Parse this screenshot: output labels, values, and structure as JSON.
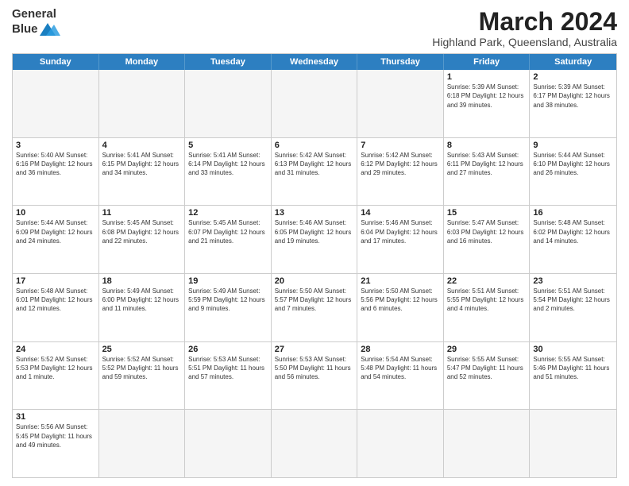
{
  "logo": {
    "general": "General",
    "blue": "Blue"
  },
  "title": "March 2024",
  "subtitle": "Highland Park, Queensland, Australia",
  "days": [
    "Sunday",
    "Monday",
    "Tuesday",
    "Wednesday",
    "Thursday",
    "Friday",
    "Saturday"
  ],
  "weeks": [
    [
      {
        "day": "",
        "info": ""
      },
      {
        "day": "",
        "info": ""
      },
      {
        "day": "",
        "info": ""
      },
      {
        "day": "",
        "info": ""
      },
      {
        "day": "",
        "info": ""
      },
      {
        "day": "1",
        "info": "Sunrise: 5:39 AM\nSunset: 6:18 PM\nDaylight: 12 hours and 39 minutes."
      },
      {
        "day": "2",
        "info": "Sunrise: 5:39 AM\nSunset: 6:17 PM\nDaylight: 12 hours and 38 minutes."
      }
    ],
    [
      {
        "day": "3",
        "info": "Sunrise: 5:40 AM\nSunset: 6:16 PM\nDaylight: 12 hours and 36 minutes."
      },
      {
        "day": "4",
        "info": "Sunrise: 5:41 AM\nSunset: 6:15 PM\nDaylight: 12 hours and 34 minutes."
      },
      {
        "day": "5",
        "info": "Sunrise: 5:41 AM\nSunset: 6:14 PM\nDaylight: 12 hours and 33 minutes."
      },
      {
        "day": "6",
        "info": "Sunrise: 5:42 AM\nSunset: 6:13 PM\nDaylight: 12 hours and 31 minutes."
      },
      {
        "day": "7",
        "info": "Sunrise: 5:42 AM\nSunset: 6:12 PM\nDaylight: 12 hours and 29 minutes."
      },
      {
        "day": "8",
        "info": "Sunrise: 5:43 AM\nSunset: 6:11 PM\nDaylight: 12 hours and 27 minutes."
      },
      {
        "day": "9",
        "info": "Sunrise: 5:44 AM\nSunset: 6:10 PM\nDaylight: 12 hours and 26 minutes."
      }
    ],
    [
      {
        "day": "10",
        "info": "Sunrise: 5:44 AM\nSunset: 6:09 PM\nDaylight: 12 hours and 24 minutes."
      },
      {
        "day": "11",
        "info": "Sunrise: 5:45 AM\nSunset: 6:08 PM\nDaylight: 12 hours and 22 minutes."
      },
      {
        "day": "12",
        "info": "Sunrise: 5:45 AM\nSunset: 6:07 PM\nDaylight: 12 hours and 21 minutes."
      },
      {
        "day": "13",
        "info": "Sunrise: 5:46 AM\nSunset: 6:05 PM\nDaylight: 12 hours and 19 minutes."
      },
      {
        "day": "14",
        "info": "Sunrise: 5:46 AM\nSunset: 6:04 PM\nDaylight: 12 hours and 17 minutes."
      },
      {
        "day": "15",
        "info": "Sunrise: 5:47 AM\nSunset: 6:03 PM\nDaylight: 12 hours and 16 minutes."
      },
      {
        "day": "16",
        "info": "Sunrise: 5:48 AM\nSunset: 6:02 PM\nDaylight: 12 hours and 14 minutes."
      }
    ],
    [
      {
        "day": "17",
        "info": "Sunrise: 5:48 AM\nSunset: 6:01 PM\nDaylight: 12 hours and 12 minutes."
      },
      {
        "day": "18",
        "info": "Sunrise: 5:49 AM\nSunset: 6:00 PM\nDaylight: 12 hours and 11 minutes."
      },
      {
        "day": "19",
        "info": "Sunrise: 5:49 AM\nSunset: 5:59 PM\nDaylight: 12 hours and 9 minutes."
      },
      {
        "day": "20",
        "info": "Sunrise: 5:50 AM\nSunset: 5:57 PM\nDaylight: 12 hours and 7 minutes."
      },
      {
        "day": "21",
        "info": "Sunrise: 5:50 AM\nSunset: 5:56 PM\nDaylight: 12 hours and 6 minutes."
      },
      {
        "day": "22",
        "info": "Sunrise: 5:51 AM\nSunset: 5:55 PM\nDaylight: 12 hours and 4 minutes."
      },
      {
        "day": "23",
        "info": "Sunrise: 5:51 AM\nSunset: 5:54 PM\nDaylight: 12 hours and 2 minutes."
      }
    ],
    [
      {
        "day": "24",
        "info": "Sunrise: 5:52 AM\nSunset: 5:53 PM\nDaylight: 12 hours and 1 minute."
      },
      {
        "day": "25",
        "info": "Sunrise: 5:52 AM\nSunset: 5:52 PM\nDaylight: 11 hours and 59 minutes."
      },
      {
        "day": "26",
        "info": "Sunrise: 5:53 AM\nSunset: 5:51 PM\nDaylight: 11 hours and 57 minutes."
      },
      {
        "day": "27",
        "info": "Sunrise: 5:53 AM\nSunset: 5:50 PM\nDaylight: 11 hours and 56 minutes."
      },
      {
        "day": "28",
        "info": "Sunrise: 5:54 AM\nSunset: 5:48 PM\nDaylight: 11 hours and 54 minutes."
      },
      {
        "day": "29",
        "info": "Sunrise: 5:55 AM\nSunset: 5:47 PM\nDaylight: 11 hours and 52 minutes."
      },
      {
        "day": "30",
        "info": "Sunrise: 5:55 AM\nSunset: 5:46 PM\nDaylight: 11 hours and 51 minutes."
      }
    ],
    [
      {
        "day": "31",
        "info": "Sunrise: 5:56 AM\nSunset: 5:45 PM\nDaylight: 11 hours and 49 minutes."
      },
      {
        "day": "",
        "info": ""
      },
      {
        "day": "",
        "info": ""
      },
      {
        "day": "",
        "info": ""
      },
      {
        "day": "",
        "info": ""
      },
      {
        "day": "",
        "info": ""
      },
      {
        "day": "",
        "info": ""
      }
    ]
  ]
}
